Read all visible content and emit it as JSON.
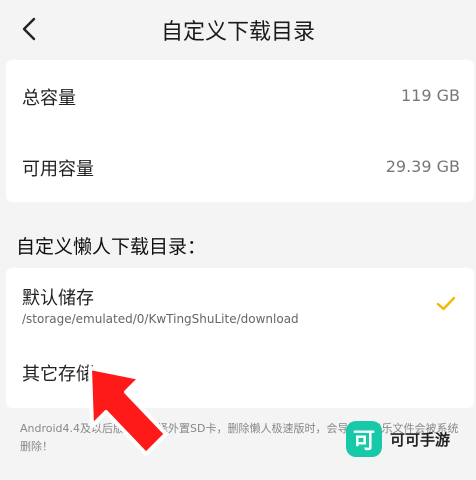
{
  "header": {
    "title": "自定义下载目录",
    "back_icon": "chevron-left-icon"
  },
  "capacity": {
    "total_label": "总容量",
    "total_value": "119 GB",
    "available_label": "可用容量",
    "available_value": "29.39 GB"
  },
  "section_title": "自定义懒人下载目录：",
  "options": {
    "default_label": "默认储存",
    "default_path": "/storage/emulated/0/KwTingShuLite/download",
    "default_selected": true,
    "other_label": "其它存储"
  },
  "note": "Android4.4及以后版本，选择外置SD卡，删除懒人极速版时，会导致的音乐文件会被系统删除！",
  "watermark": {
    "logo_char": "可",
    "text": "可可手游"
  },
  "colors": {
    "accent": "#f5b800",
    "arrow": "#ff1a1a",
    "watermark": "#17c9a8"
  }
}
